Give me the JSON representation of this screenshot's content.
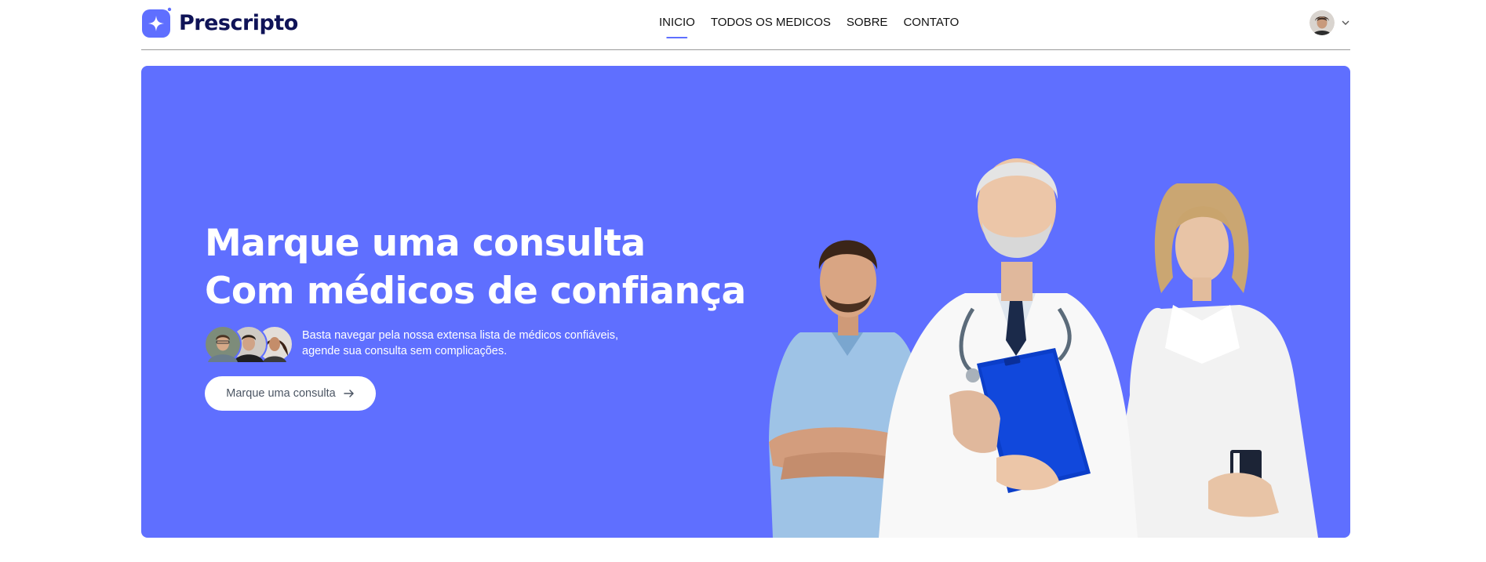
{
  "app": {
    "name": "Prescripto",
    "brand_color": "#5f6fff",
    "brand_dark": "#0f1357"
  },
  "nav": {
    "items": [
      {
        "label": "INICIO",
        "active": true
      },
      {
        "label": "TODOS OS MEDICOS",
        "active": false
      },
      {
        "label": "SOBRE",
        "active": false
      },
      {
        "label": "CONTATO",
        "active": false
      }
    ]
  },
  "profile": {
    "avatar_icon": "user-avatar",
    "dropdown_icon": "chevron-down-icon"
  },
  "hero": {
    "title_line1": "Marque uma consulta",
    "title_line2": "Com médicos de confiança",
    "description_line1": "Basta navegar pela nossa extensa lista de médicos confiáveis,",
    "description_line2": "agende sua consulta sem complicações.",
    "cta_label": "Marque uma consulta",
    "cta_icon": "arrow-right-icon",
    "background_color": "#5f6fff"
  }
}
